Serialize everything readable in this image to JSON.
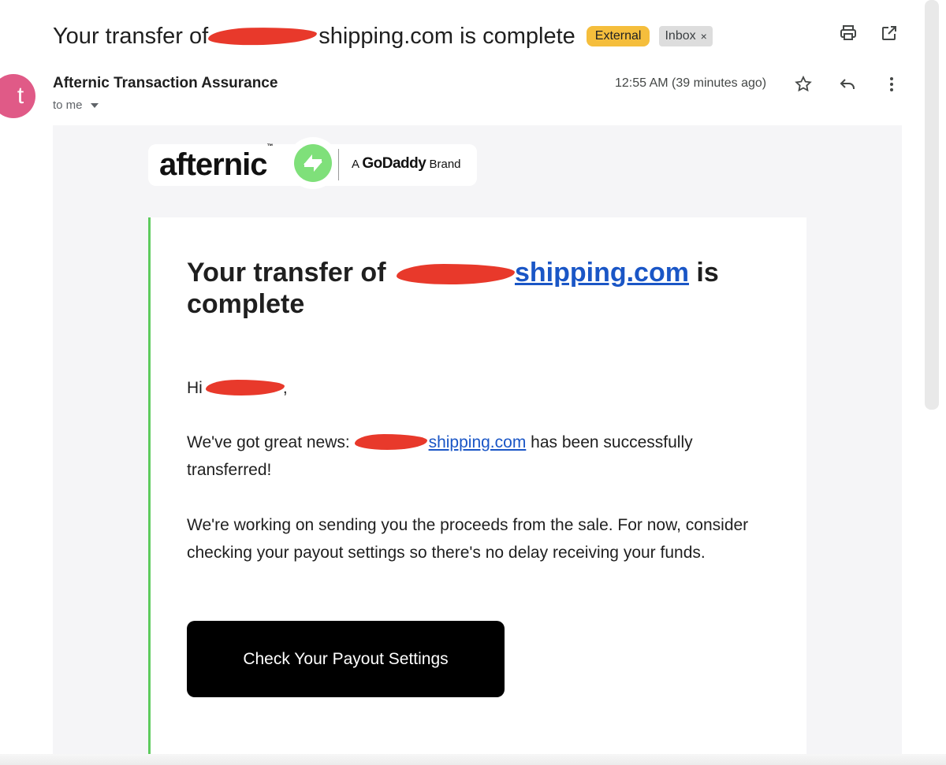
{
  "subject": {
    "prefix": "Your transfer of",
    "domain_suffix": "shipping.com",
    "suffix": "is complete",
    "labels": {
      "external": "External",
      "inbox": "Inbox",
      "inbox_remove": "×"
    }
  },
  "top_icons": [
    "printer-icon",
    "open-in-new-window-icon"
  ],
  "message": {
    "avatar_letter": "t",
    "avatar_color": "#e05a87",
    "sender": "Afternic Transaction Assurance",
    "recipient": "to me",
    "timestamp": "12:55 AM (39 minutes ago)",
    "action_icons": [
      "star-icon",
      "reply-icon",
      "more-vert-icon"
    ]
  },
  "email": {
    "logo": {
      "word": "afternic",
      "tm": "™",
      "a": "A",
      "godaddy": "GoDaddy",
      "brand": "Brand"
    },
    "title_prefix": "Your transfer of",
    "title_link": "shipping.com",
    "title_suffix": "is complete",
    "greeting_prefix": "Hi",
    "greeting_suffix": ",",
    "para1_prefix": "We've got great news:",
    "para1_link": "shipping.com",
    "para1_suffix": "has been successfully transferred!",
    "para2": "We're working on sending you the proceeds from the sale. For now, consider checking your payout settings so there's no delay receiving your funds.",
    "cta": "Check Your Payout Settings",
    "accent_color": "#5ecb5e",
    "link_color": "#1a56c6"
  }
}
